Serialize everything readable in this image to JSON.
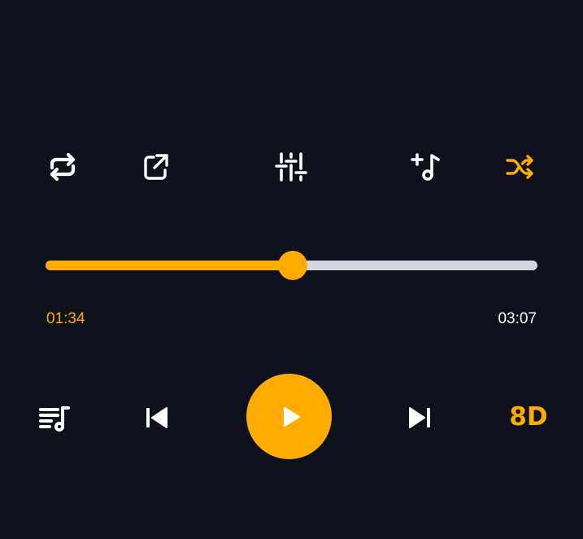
{
  "toolbar": {
    "repeat_icon": "repeat-icon",
    "share_icon": "share-icon",
    "equalizer_icon": "equalizer-icon",
    "add_to_playlist_icon": "music-note-plus-icon",
    "shuffle_icon": "shuffle-icon",
    "shuffle_active": true
  },
  "progress": {
    "elapsed": "01:34",
    "total": "03:07",
    "fraction": 0.503
  },
  "controls": {
    "queue_icon": "queue-music-icon",
    "previous_icon": "skip-previous-icon",
    "play_icon": "play-icon",
    "next_icon": "skip-next-icon",
    "audio_mode_label": "8D"
  },
  "colors": {
    "background": "#0d111c",
    "accent": "#ffab00",
    "icon": "#ffffff",
    "track": "#d3d6de"
  }
}
